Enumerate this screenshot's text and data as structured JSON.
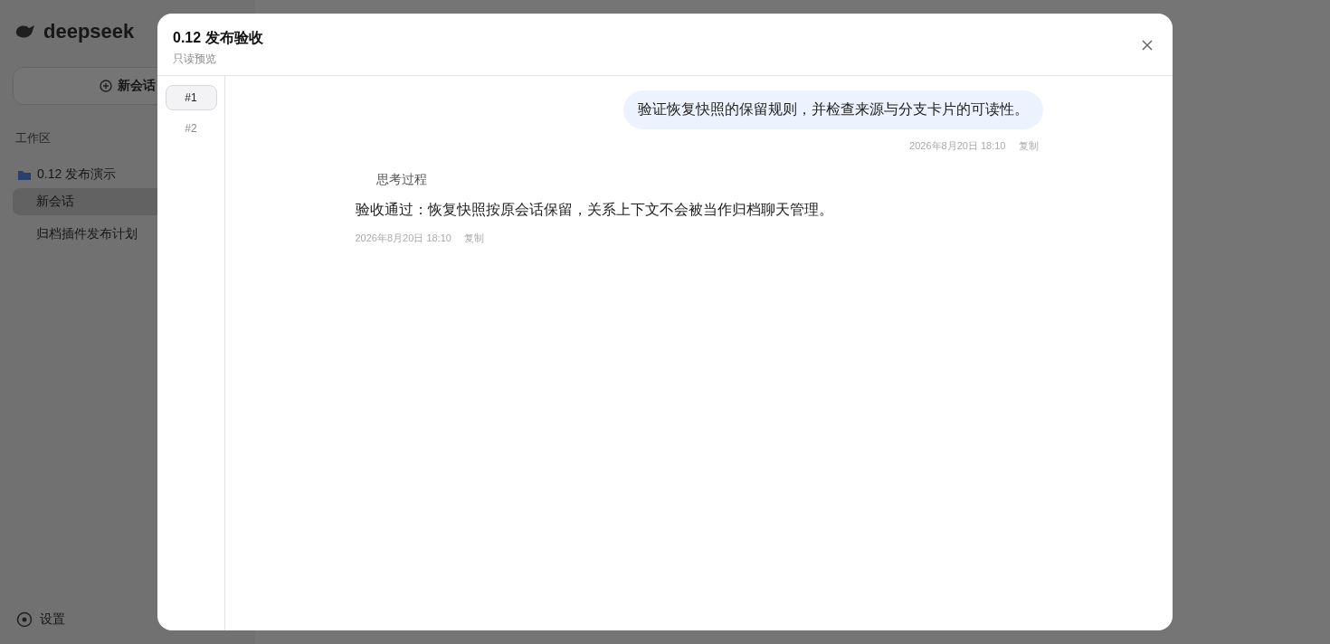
{
  "backdrop": {
    "logo": "deepseek",
    "new_chat": "新会话",
    "section": "工作区",
    "folder": "0.12 发布演示",
    "items": [
      {
        "label": "新会话",
        "selected": true
      },
      {
        "label": "归档插件发布计划",
        "selected": false
      }
    ],
    "settings": "设置"
  },
  "dialog": {
    "title": "0.12 发布验收",
    "subtitle": "只读预览",
    "rail": [
      {
        "label": "#1",
        "selected": true
      },
      {
        "label": "#2",
        "selected": false
      }
    ],
    "messages": [
      {
        "kind": "user",
        "text": "验证恢复快照的保留规则，并检查来源与分支卡片的可读性。",
        "time": "2026年8月20日 18:10",
        "action": "复制"
      },
      {
        "kind": "assistant",
        "thinking": "思考过程",
        "text": "验收通过：恢复快照按原会话保留，关系上下文不会被当作归档聊天管理。",
        "time": "2026年8月20日 18:10",
        "action": "复制"
      }
    ]
  }
}
